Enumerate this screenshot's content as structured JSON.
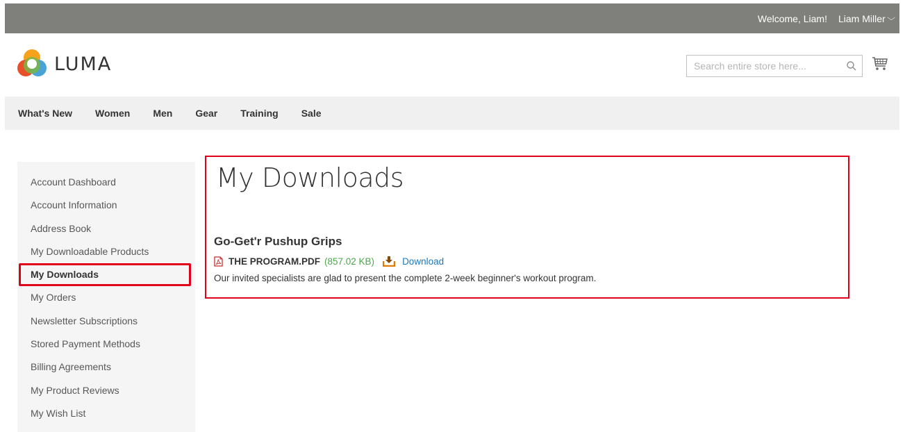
{
  "header": {
    "welcome": "Welcome, Liam!",
    "account_name": "Liam Miller",
    "account_chevron_icon": "chevron-down-icon"
  },
  "logo": {
    "text": "LUMA"
  },
  "search": {
    "placeholder": "Search entire store here...",
    "value": ""
  },
  "nav": {
    "items": [
      "What's New",
      "Women",
      "Men",
      "Gear",
      "Training",
      "Sale"
    ]
  },
  "sidebar": {
    "items": [
      "Account Dashboard",
      "Account Information",
      "Address Book",
      "My Downloadable Products",
      "My Downloads",
      "My Orders",
      "Newsletter Subscriptions",
      "Stored Payment Methods",
      "Billing Agreements",
      "My Product Reviews",
      "My Wish List"
    ],
    "active": "My Downloads"
  },
  "main": {
    "title": "My Downloads",
    "product_name": "Go-Get'r Pushup Grips",
    "file_name": "THE PROGRAM.PDF",
    "file_size": "(857.02 KB)",
    "download_label": "Download",
    "description": "Our invited specialists are glad to present the complete 2-week beginner's workout program."
  },
  "colors": {
    "topbar": "#7f7f7b",
    "nav_bg": "#f0f0f0",
    "sidebar_bg": "#f5f5f5",
    "highlight": "#e0001a",
    "link": "#1979c3",
    "file_size": "#4ca64c",
    "download_icon": "#e07b00"
  }
}
